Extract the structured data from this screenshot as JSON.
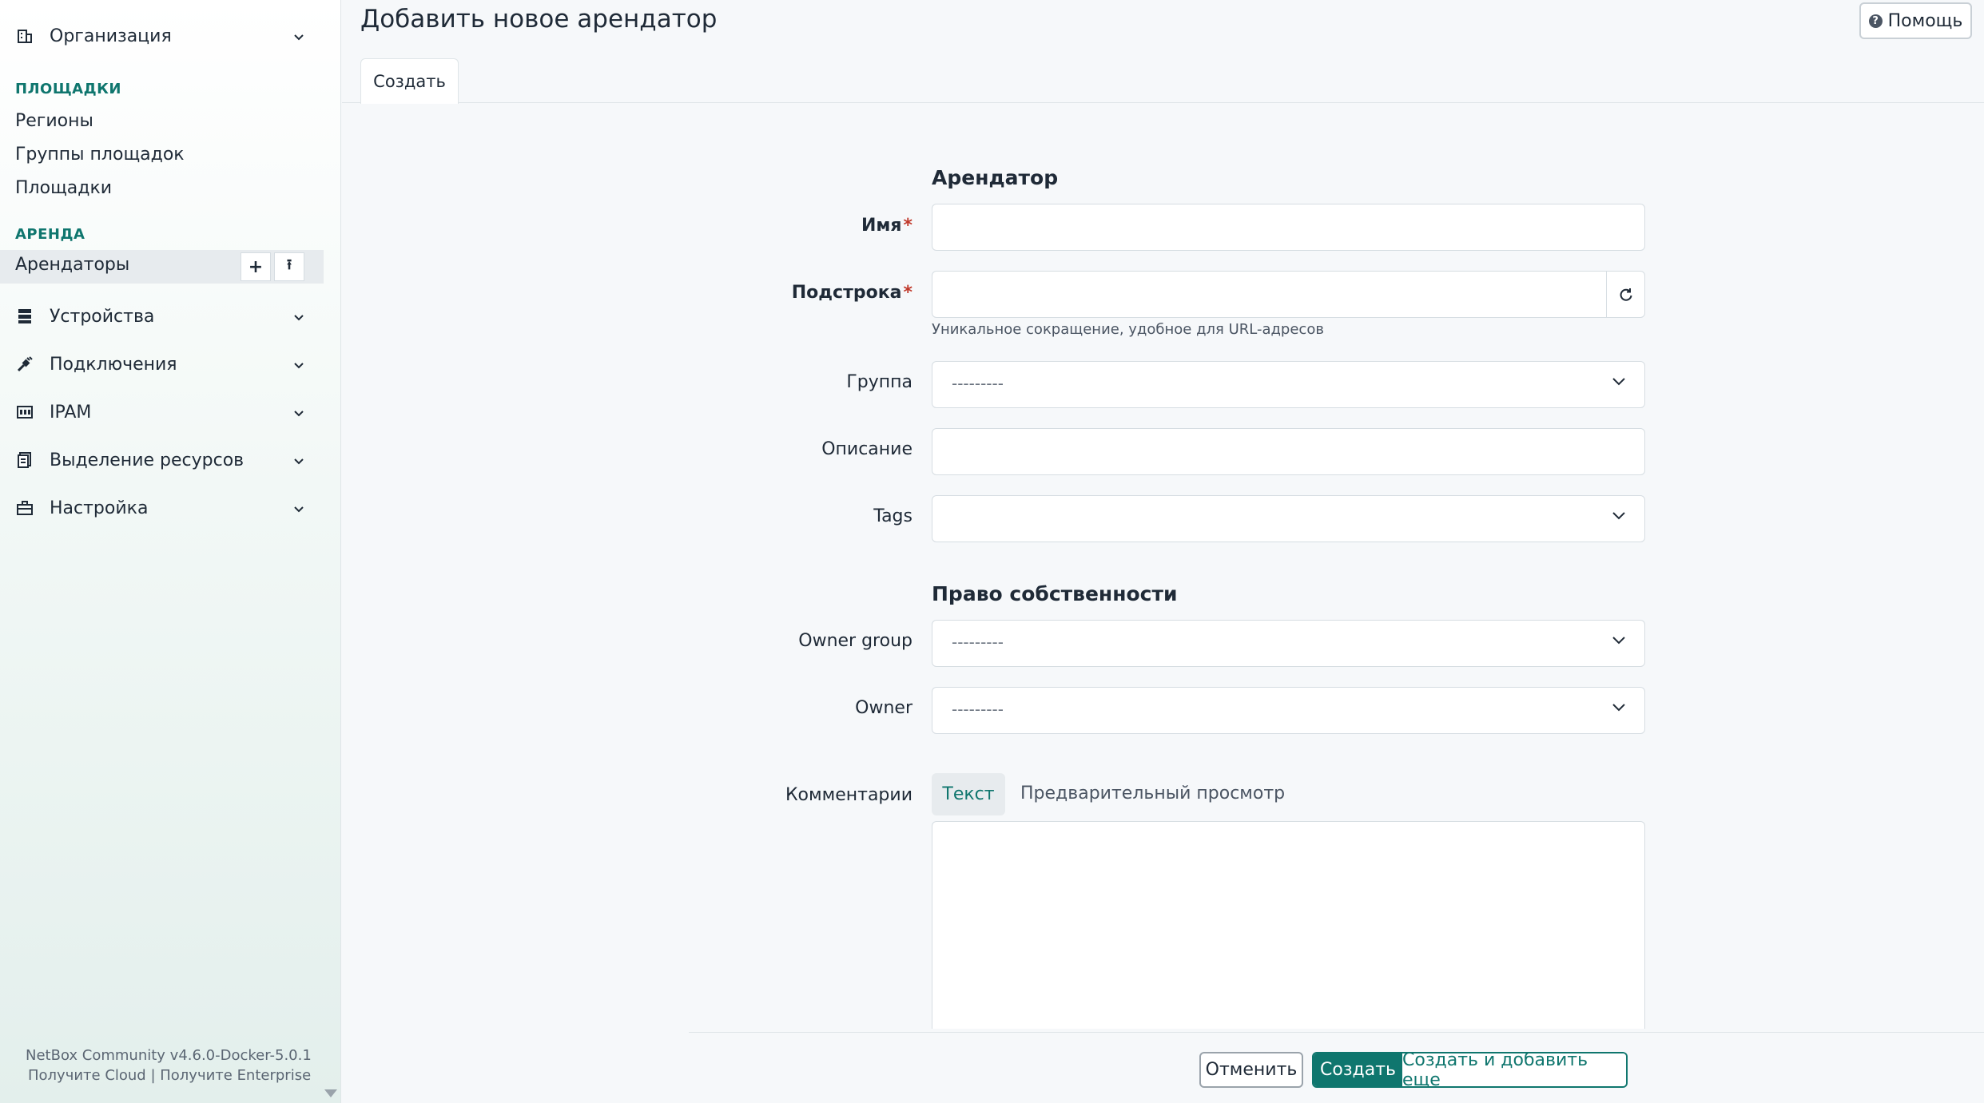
{
  "sidebar": {
    "organization_label": "Организация",
    "group_sites": "ПЛОЩАДКИ",
    "link_regions": "Регионы",
    "link_site_groups": "Группы площадок",
    "link_sites": "Площадки",
    "group_tenancy": "АРЕНДА",
    "active_item": "Арендаторы",
    "active_add": "+",
    "active_import": "⭱",
    "sections": {
      "devices": "Устройства",
      "connections": "Подключения",
      "ipam": "IPAM",
      "provisioning": "Выделение ресурсов",
      "customization": "Настройка"
    },
    "footer": {
      "version": "NetBox Community v4.6.0-Docker-5.0.1",
      "links": "Получите Cloud | Получите Enterprise"
    }
  },
  "header": {
    "title": "Добавить новое арендатор",
    "help_label": "Помощь",
    "tab_create": "Создать"
  },
  "form": {
    "section_tenant": "Арендатор",
    "name_label": "Имя",
    "slug_label": "Подстрока",
    "slug_hint": "Уникальное сокращение, удобное для URL-адресов",
    "group_label": "Группа",
    "group_value": "---------",
    "description_label": "Описание",
    "tags_label": "Tags",
    "section_ownership": "Право собственности",
    "owner_group_label": "Owner group",
    "owner_group_value": "---------",
    "owner_label": "Owner",
    "owner_value": "---------",
    "comments_label": "Комментарии",
    "tab_text": "Текст",
    "tab_preview": "Предварительный просмотр",
    "required_mark": "*"
  },
  "actions": {
    "cancel": "Отменить",
    "create": "Создать",
    "create_and_add": "Создать и добавить еще"
  },
  "colors": {
    "accent": "#0f766e",
    "required": "#c0392b"
  }
}
